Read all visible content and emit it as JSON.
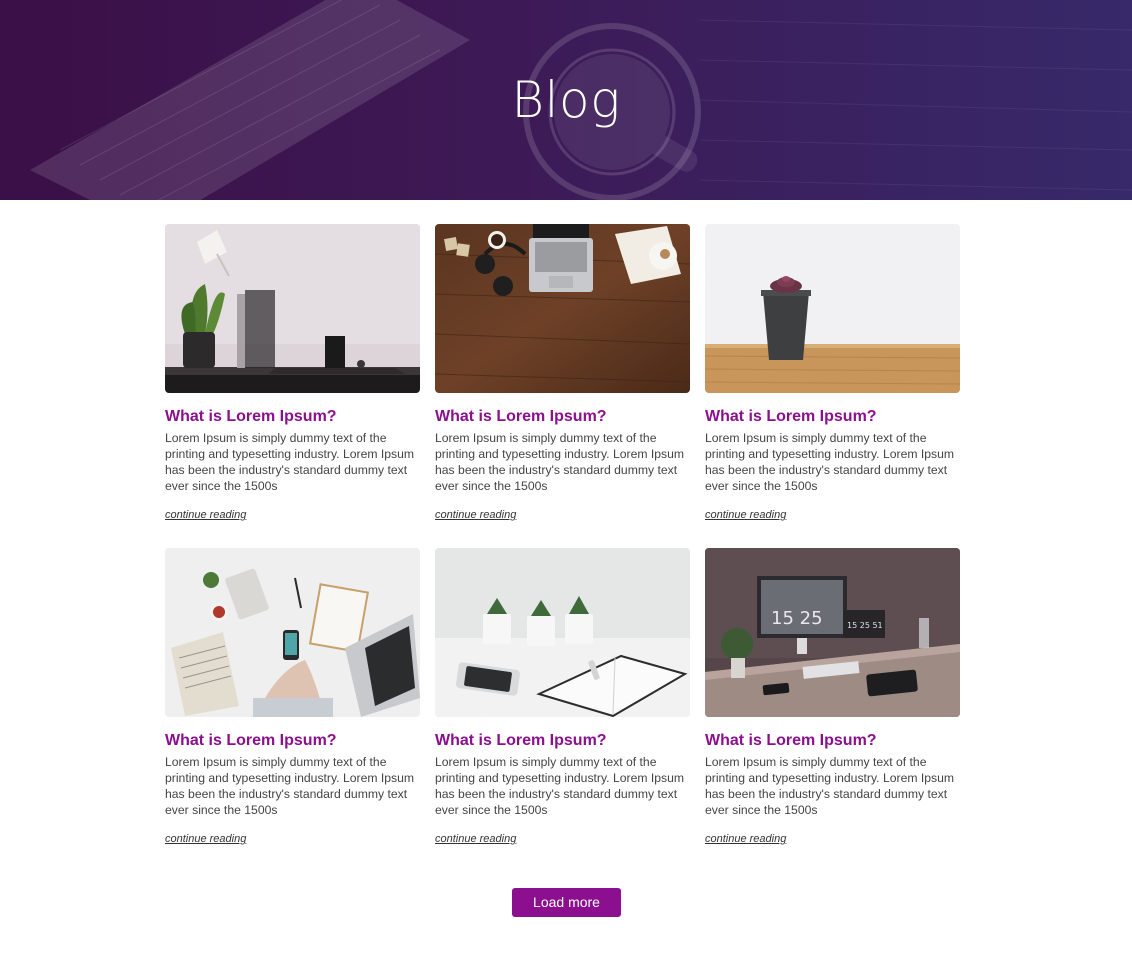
{
  "header": {
    "title": "Blog"
  },
  "posts": [
    {
      "image": "desk-lamp-plant-laptop",
      "title": "What is Lorem Ipsum?",
      "excerpt": "Lorem Ipsum is simply dummy text of the printing and typesetting industry. Lorem Ipsum has been the industry's standard dummy text ever since the 1500s",
      "link": "continue reading"
    },
    {
      "image": "wooden-desk-laptop-headphones",
      "title": "What is Lorem Ipsum?",
      "excerpt": "Lorem Ipsum is simply dummy text of the printing and typesetting industry. Lorem Ipsum has been the industry's standard dummy text ever since the 1500s",
      "link": "continue reading"
    },
    {
      "image": "succulent-pot-on-wood",
      "title": "What is Lorem Ipsum?",
      "excerpt": "Lorem Ipsum is simply dummy text of the printing and typesetting industry. Lorem Ipsum has been the industry's standard dummy text ever since the 1500s",
      "link": "continue reading"
    },
    {
      "image": "flatlay-phone-calculator-laptop",
      "title": "What is Lorem Ipsum?",
      "excerpt": "Lorem Ipsum is simply dummy text of the printing and typesetting industry. Lorem Ipsum has been the industry's standard dummy text ever since the 1500s",
      "link": "continue reading"
    },
    {
      "image": "white-desk-plants-notebook",
      "title": "What is Lorem Ipsum?",
      "excerpt": "Lorem Ipsum is simply dummy text of the printing and typesetting industry. Lorem Ipsum has been the industry's standard dummy text ever since the 1500s",
      "link": "continue reading"
    },
    {
      "image": "workspace-monitors-clock",
      "title": "What is Lorem Ipsum?",
      "excerpt": "Lorem Ipsum is simply dummy text of the printing and typesetting industry. Lorem Ipsum has been the industry's standard dummy text ever since the 1500s",
      "link": "continue reading"
    }
  ],
  "photo_clock_text": [
    "15 25",
    "15 25 51"
  ],
  "load_more_label": "Load more",
  "colors": {
    "accent": "#8b0f8e",
    "hero_left": "#3b0f47",
    "hero_right": "#37296a",
    "body_text": "#444444"
  }
}
